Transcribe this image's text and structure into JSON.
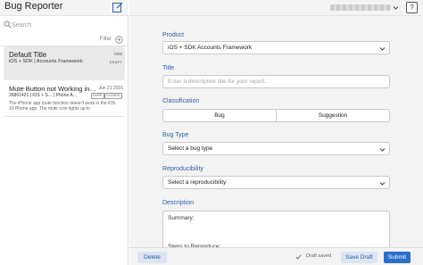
{
  "sidebar": {
    "app_title": "Bug Reporter",
    "search_placeholder": "Search",
    "filter_label": "Filter",
    "items": [
      {
        "title": "Default Title",
        "time": "now",
        "product": "iOS + SDK  |  Accounts Framework",
        "status": "DRAFT"
      },
      {
        "title": "Mute Button not Working in…",
        "date": "Jun 21 2016",
        "meta": "26861421  |  iOS + S…  |  Phone A…",
        "badge_dupe": "DUPE",
        "badge_closed": "CLOSED",
        "description": "The iPhone app mute function doesn't work in the iOS 10 Phone app. The mute icon lights up to"
      }
    ]
  },
  "header": {
    "help_label": "?"
  },
  "form": {
    "product_label": "Product",
    "product_value": "iOS + SDK Accounts Framework",
    "title_label": "Title",
    "title_placeholder": "Enter a descriptive title for your report.",
    "classification_label": "Classification",
    "classification_options": [
      "Bug",
      "Suggestion"
    ],
    "bug_type_label": "Bug Type",
    "bug_type_value": "Select a bug type",
    "reproducibility_label": "Reproducibility",
    "reproducibility_value": "Select a reproducibility",
    "description_label": "Description",
    "description_value": "Summary:\n\n\n\nSteps to Reproduce:"
  },
  "footer": {
    "delete_label": "Delete",
    "draft_status": "Draft saved",
    "save_label": "Save Draft",
    "submit_label": "Submit"
  },
  "colors": {
    "accent": "#2c6ec8",
    "label_blue": "#2b5ea8",
    "secondary_button_bg": "#dbe4f3"
  }
}
